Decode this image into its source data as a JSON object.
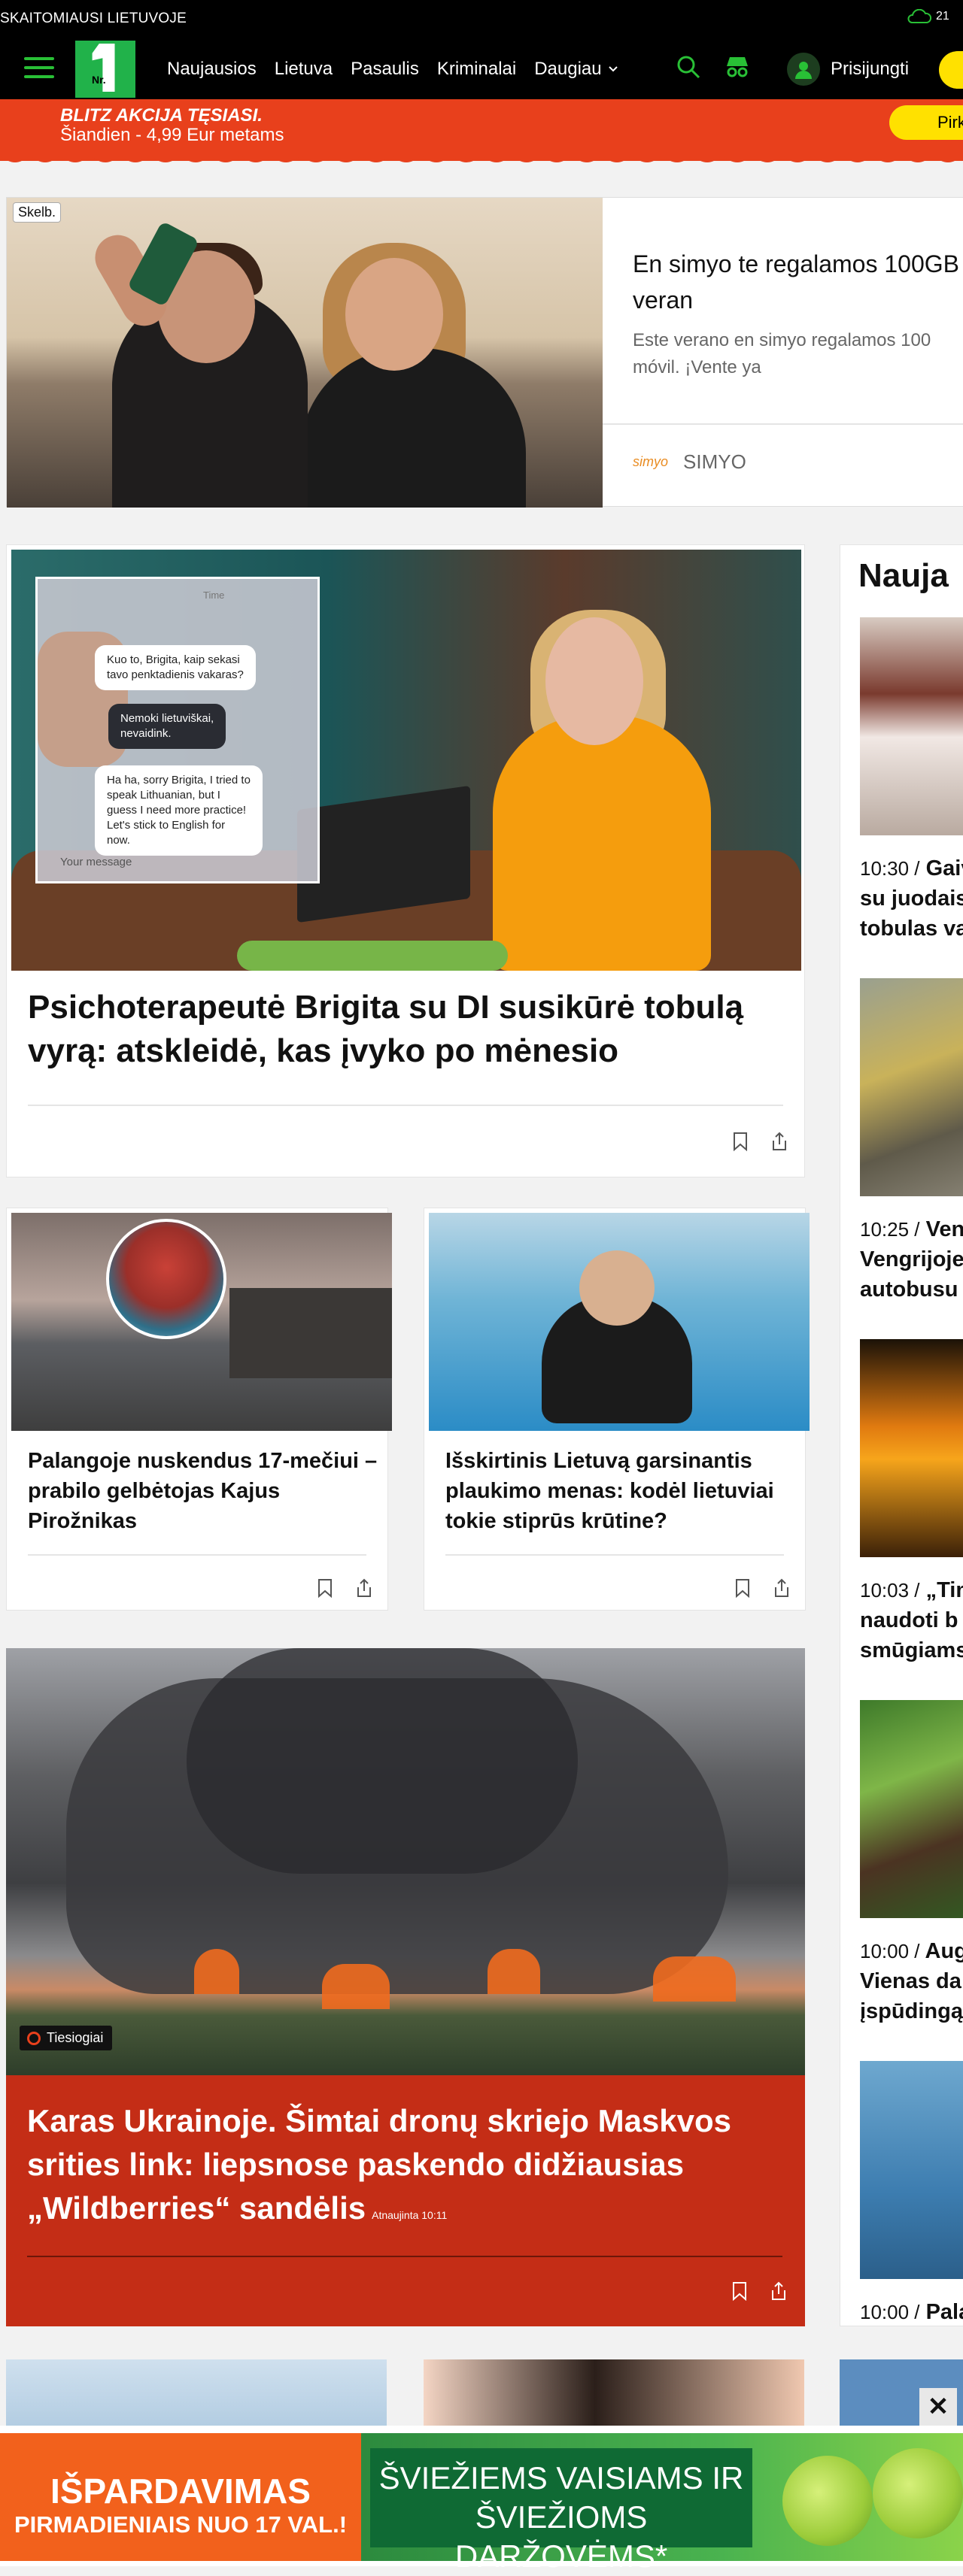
{
  "topbar": {
    "tagline": "SKAITOMIAUSI LIETUVOJE",
    "temperature": "21"
  },
  "nav": {
    "items": [
      "Naujausios",
      "Lietuva",
      "Pasaulis",
      "Kriminalai",
      "Daugiau"
    ],
    "login_label": "Prisijungti",
    "logo_text": "Nr."
  },
  "promo": {
    "line1": "BLITZ AKCIJA TĘSIASI.",
    "line2": "Šiandien - 4,99 Eur metams",
    "button": "Pirk"
  },
  "ad": {
    "badge": "Skelb.",
    "title": "En simyo te regalamos 100GB\nveran",
    "description": "Este verano en simyo regalamos 100\nmóvil. ¡Vente ya",
    "brand_logo": "simyo",
    "brand_name": "SIMYO"
  },
  "articles": {
    "main1": {
      "headline": "Psichoterapeutė Brigita su DI susikūrė tobulą vyrą: atskleidė, kas įvyko po mėnesio",
      "chat": {
        "msg1": "Kuo to, Brigita, kaip sekasi\ntavo penktadienis vakaras?",
        "msg2": "Nemoki lietuviškai,\nnevaidink.",
        "msg3": "Ha ha, sorry Brigita, I tried to\nspeak Lithuanian, but I\nguess I need more practice!\nLet's stick to English for\nnow.",
        "input_placeholder": "Your message",
        "top_label": "Time"
      }
    },
    "small1": {
      "headline": "Palangoje nuskendus 17-mečiui – prabilo gelbėtojas Kajus Pirožnikas"
    },
    "small2": {
      "headline": "Išskirtinis Lietuvą garsinantis plaukimo menas: kodėl lietuviai tokie stiprūs krūtine?"
    },
    "main2": {
      "live_label": "Tiesiogiai",
      "headline": "Karas Ukrainoje. Šimtai dronų skriejo Maskvos srities link: liepsnose paskendo didžiausias „Wildberries“ sandėlis",
      "updated": "Atnaujinta 10:11"
    }
  },
  "sidebar": {
    "title": "Nauja",
    "items": [
      {
        "time": "10:30 /",
        "lines": [
          "Gaiv",
          "su juodais",
          "tobulas va"
        ]
      },
      {
        "time": "10:25 /",
        "lines": [
          "Veng",
          "Vengrijoje",
          "autobusu"
        ]
      },
      {
        "time": "10:03 /",
        "lines": [
          "„Tim",
          "naudoti b",
          "smūgiams"
        ]
      },
      {
        "time": "10:00 /",
        "lines": [
          "Aug",
          "Vienas da",
          "įspūdingą"
        ]
      },
      {
        "time": "10:00 /",
        "lines": [
          "Pala"
        ]
      }
    ]
  },
  "bottom_ad": {
    "left_line1": "IŠPARDAVIMAS",
    "left_line2": "PIRMADIENIAIS NUO 17 VAL.!",
    "right_text": "ŠVIEŽIEMS VAISIAMS IR\nŠVIEŽIOMS DARŽOVĖMS*",
    "close": "✕"
  },
  "colors": {
    "brand_green": "#21b24a",
    "promo_orange": "#e8401c",
    "yellow": "#ffe100",
    "live_red": "#c42d16"
  }
}
